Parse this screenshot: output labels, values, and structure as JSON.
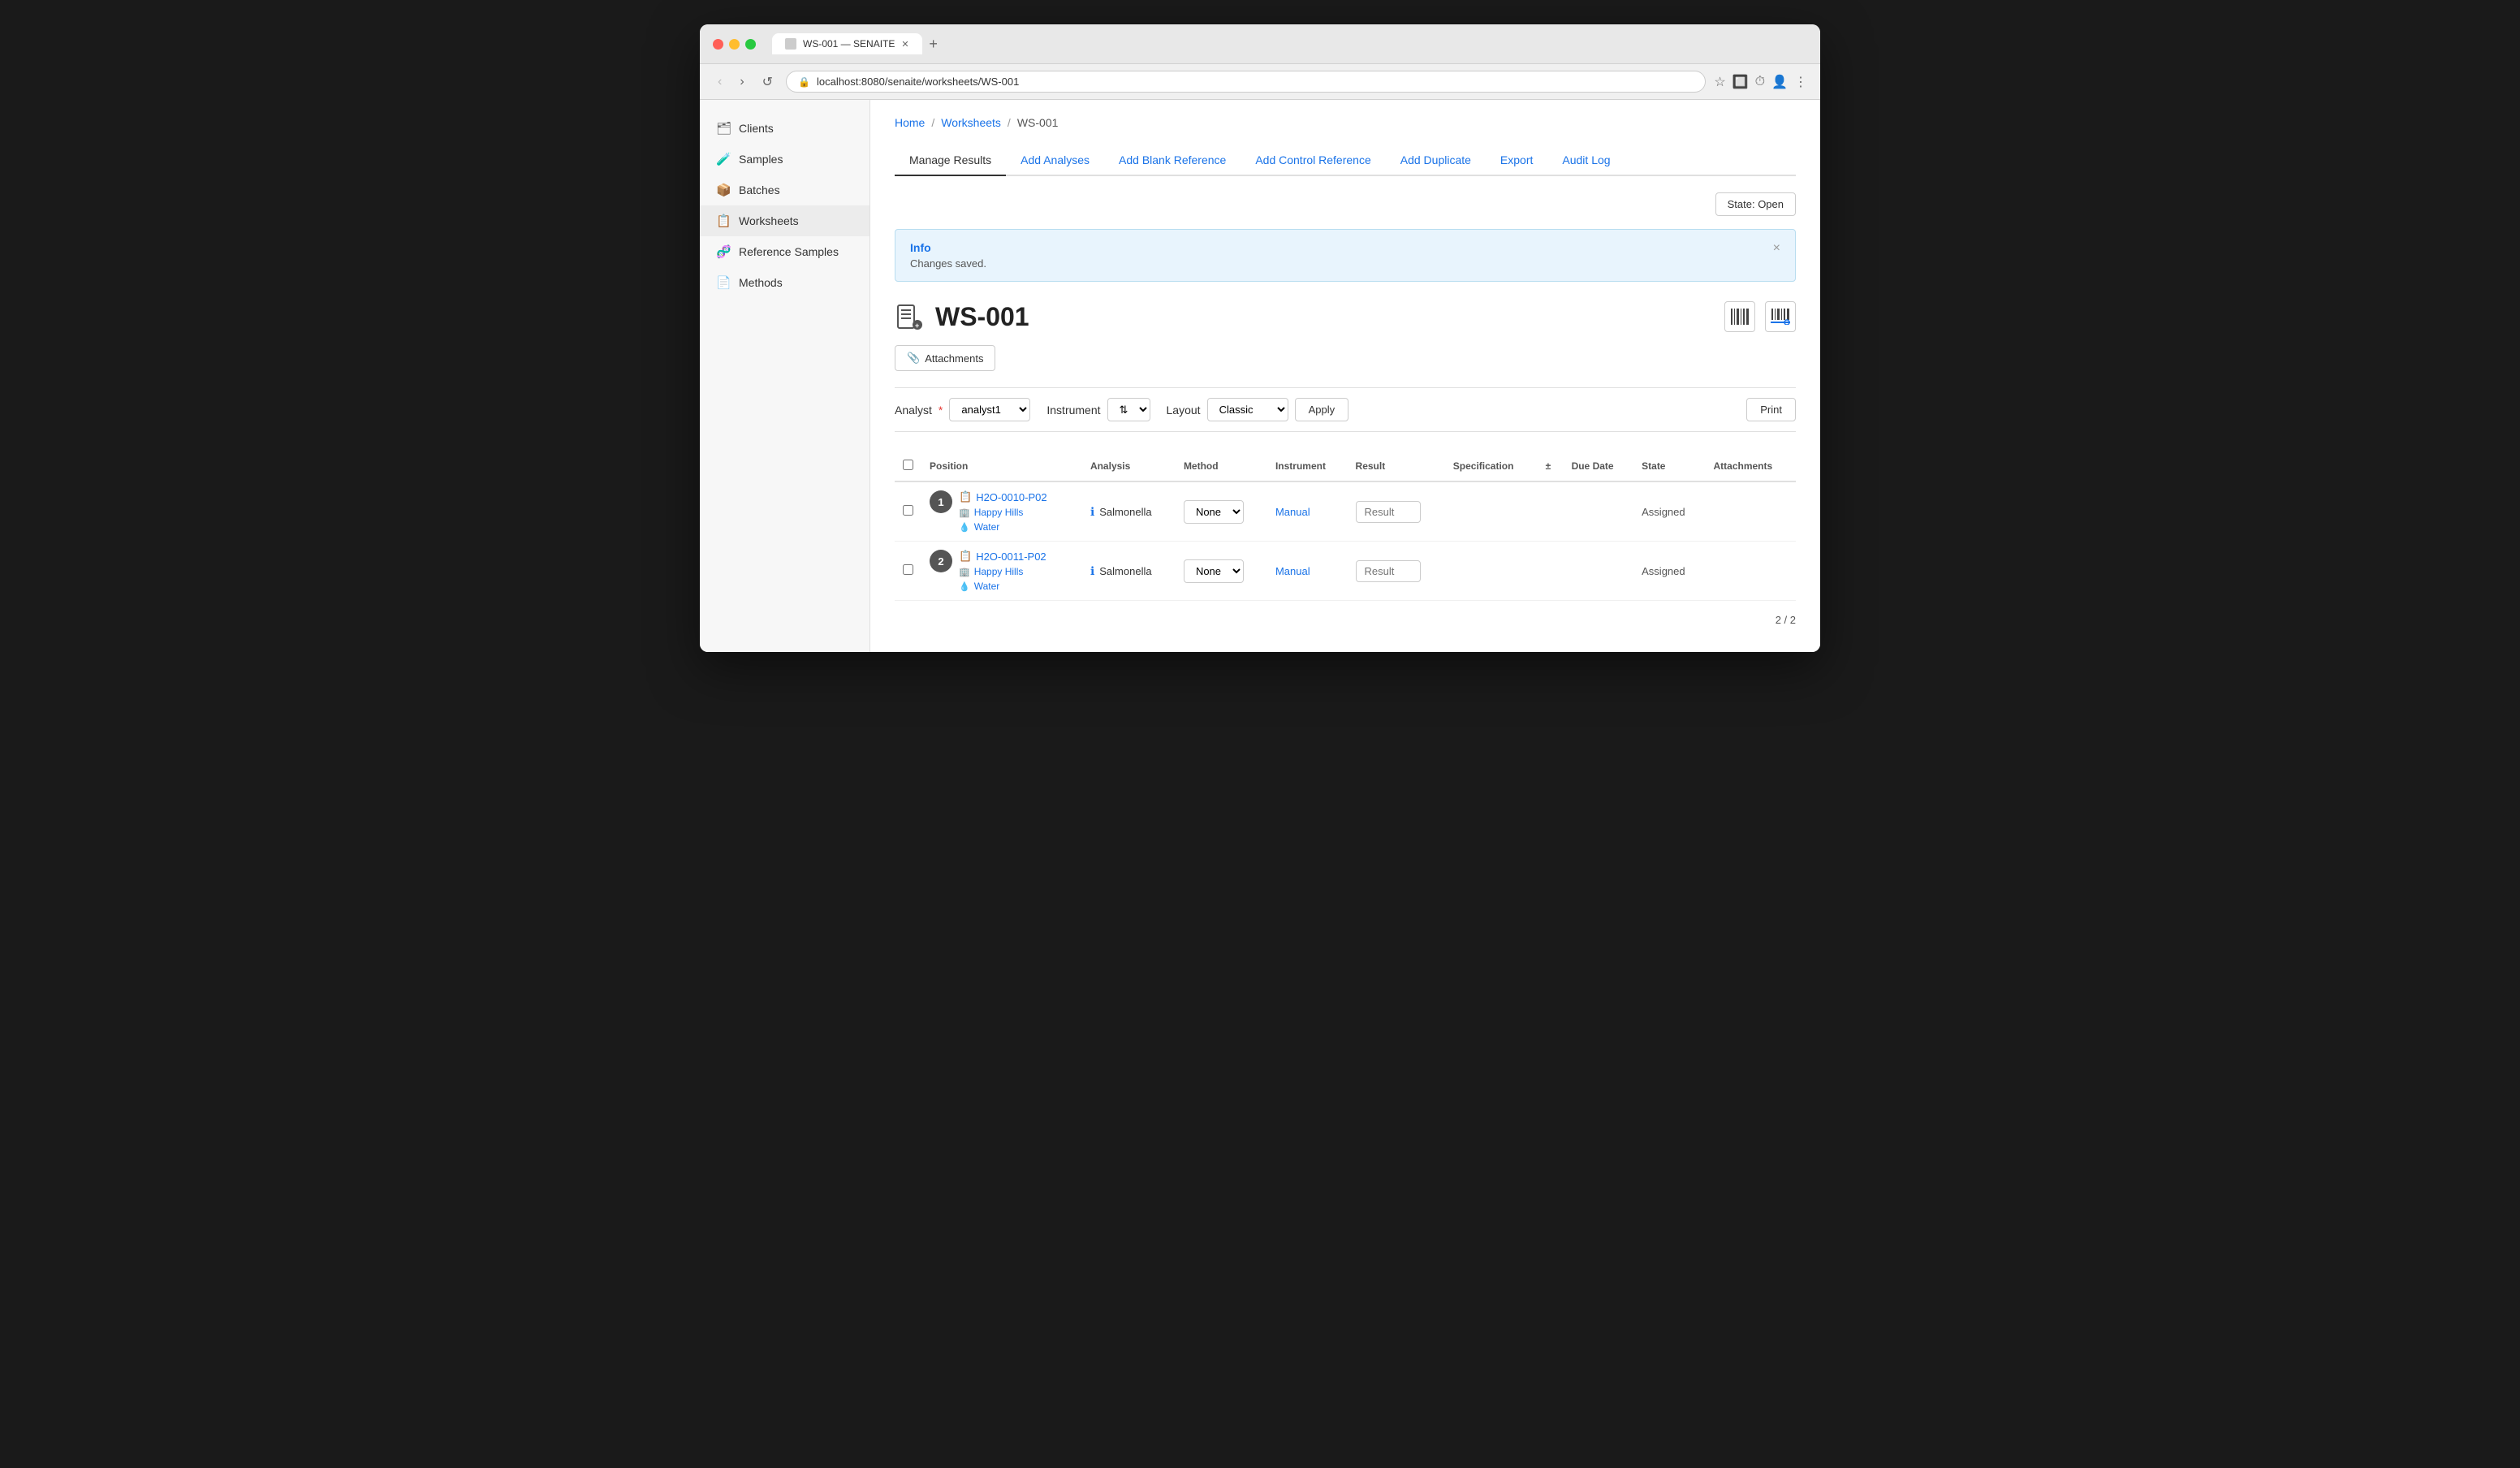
{
  "browser": {
    "tab_title": "WS-001 — SENAITE",
    "url": "localhost:8080/senaite/worksheets/WS-001",
    "new_tab_label": "+"
  },
  "breadcrumb": {
    "home": "Home",
    "worksheets": "Worksheets",
    "current": "WS-001"
  },
  "tabs": [
    {
      "id": "manage-results",
      "label": "Manage Results",
      "active": true
    },
    {
      "id": "add-analyses",
      "label": "Add Analyses",
      "active": false
    },
    {
      "id": "add-blank-reference",
      "label": "Add Blank Reference",
      "active": false
    },
    {
      "id": "add-control-reference",
      "label": "Add Control Reference",
      "active": false
    },
    {
      "id": "add-duplicate",
      "label": "Add Duplicate",
      "active": false
    },
    {
      "id": "export",
      "label": "Export",
      "active": false
    },
    {
      "id": "audit-log",
      "label": "Audit Log",
      "active": false
    }
  ],
  "state_badge": "State: Open",
  "info_banner": {
    "title": "Info",
    "message": "Changes saved.",
    "close_label": "×"
  },
  "worksheet": {
    "id": "WS-001",
    "attachments_label": "Attachments"
  },
  "analyst_row": {
    "analyst_label": "Analyst",
    "analyst_value": "analyst1",
    "instrument_label": "Instrument",
    "instrument_placeholder": "⇅",
    "layout_label": "Layout",
    "layout_value": "Classic",
    "apply_label": "Apply",
    "print_label": "Print"
  },
  "table": {
    "headers": [
      {
        "id": "check",
        "label": ""
      },
      {
        "id": "position",
        "label": "Position"
      },
      {
        "id": "analysis",
        "label": "Analysis"
      },
      {
        "id": "method",
        "label": "Method"
      },
      {
        "id": "instrument",
        "label": "Instrument"
      },
      {
        "id": "result",
        "label": "Result"
      },
      {
        "id": "specification",
        "label": "Specification"
      },
      {
        "id": "plusminus",
        "label": "±"
      },
      {
        "id": "due-date",
        "label": "Due Date"
      },
      {
        "id": "state",
        "label": "State"
      },
      {
        "id": "attachments",
        "label": "Attachments"
      }
    ],
    "rows": [
      {
        "position_num": "1",
        "sample_id": "H2O-0010-P02",
        "client": "Happy Hills",
        "matrix": "Water",
        "analysis": "Salmonella",
        "method": "None",
        "instrument": "Manual",
        "result_placeholder": "Result",
        "specification": "",
        "due_date": "",
        "state": "Assigned"
      },
      {
        "position_num": "2",
        "sample_id": "H2O-0011-P02",
        "client": "Happy Hills",
        "matrix": "Water",
        "analysis": "Salmonella",
        "method": "None",
        "instrument": "Manual",
        "result_placeholder": "Result",
        "specification": "",
        "due_date": "",
        "state": "Assigned"
      }
    ]
  },
  "pagination": {
    "current": "2",
    "total": "2",
    "label": "2 / 2"
  },
  "sidebar": {
    "items": [
      {
        "id": "clients",
        "label": "Clients",
        "icon": "🗂"
      },
      {
        "id": "samples",
        "label": "Samples",
        "icon": "🧪"
      },
      {
        "id": "batches",
        "label": "Batches",
        "icon": "📦"
      },
      {
        "id": "worksheets",
        "label": "Worksheets",
        "icon": "📋"
      },
      {
        "id": "reference-samples",
        "label": "Reference Samples",
        "icon": "🧬"
      },
      {
        "id": "methods",
        "label": "Methods",
        "icon": "📄"
      }
    ]
  }
}
